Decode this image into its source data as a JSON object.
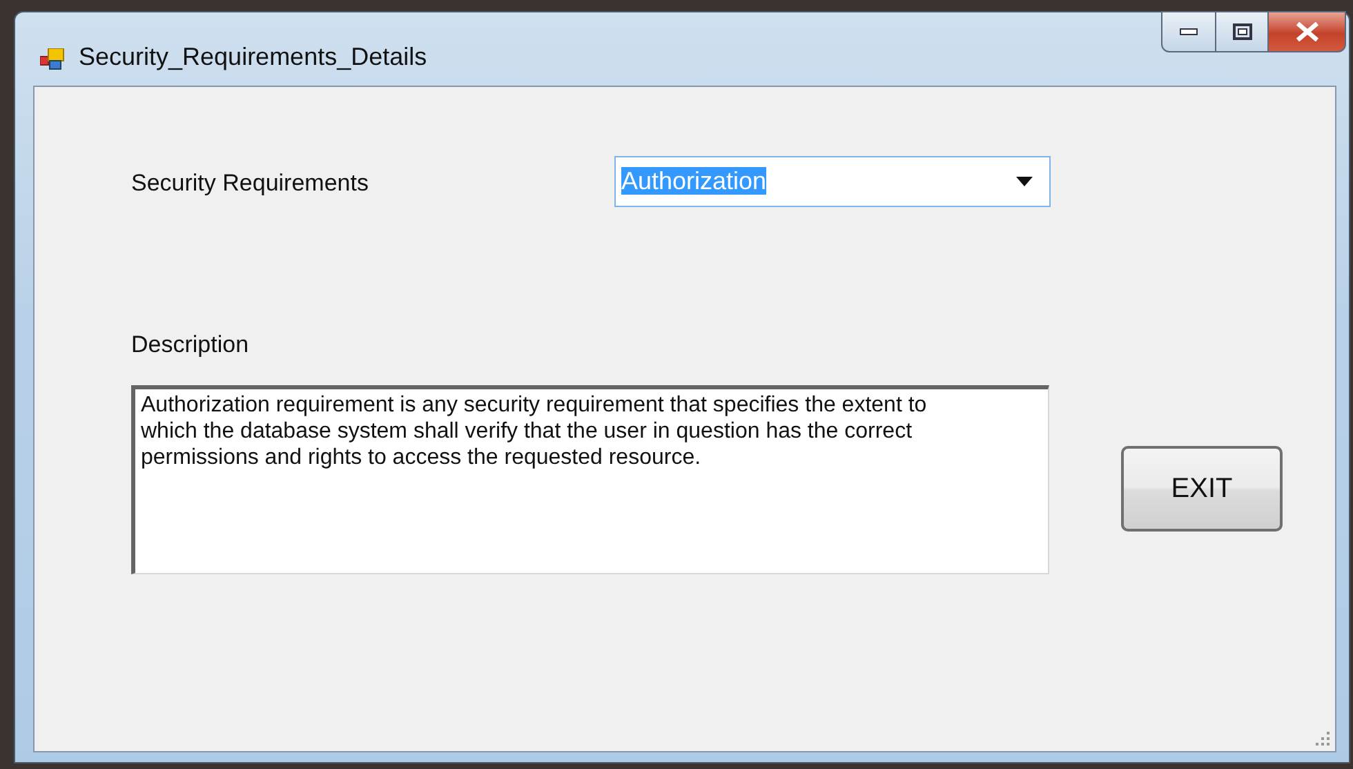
{
  "window": {
    "title": "Security_Requirements_Details"
  },
  "form": {
    "requirement_label": "Security Requirements",
    "requirement_combo": {
      "value": "Authorization",
      "text_selected": true
    },
    "description_label": "Description",
    "description_field": {
      "value": "Authorization requirement is any security requirement that specifies the extent to which the database system shall verify that the user in question has the correct permissions and rights to access the requested resource."
    },
    "buttons": [
      {
        "label": "EXIT"
      }
    ]
  }
}
